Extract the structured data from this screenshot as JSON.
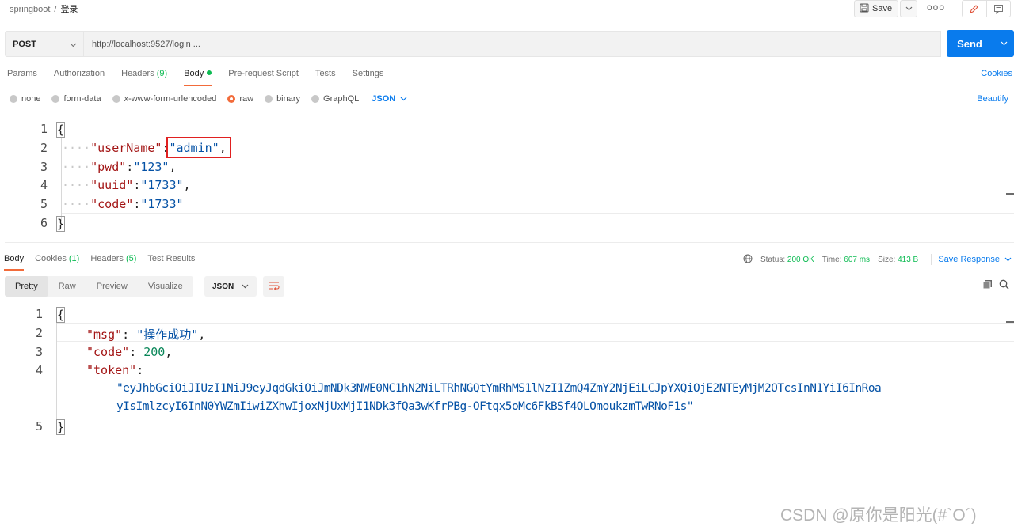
{
  "breadcrumb": {
    "collection": "springboot",
    "separator": "/",
    "request": "登录"
  },
  "toolbar": {
    "save_label": "Save",
    "more": "ooo"
  },
  "request": {
    "method": "POST",
    "url": "http://localhost:9527/login ...",
    "send_label": "Send"
  },
  "req_tabs": [
    {
      "label": "Params"
    },
    {
      "label": "Authorization"
    },
    {
      "label": "Headers",
      "count": " (9)"
    },
    {
      "label": "Body"
    },
    {
      "label": "Pre-request Script"
    },
    {
      "label": "Tests"
    },
    {
      "label": "Settings"
    }
  ],
  "cookies_label": "Cookies",
  "body_types": {
    "none": "none",
    "form_data": "form-data",
    "urlencoded": "x-www-form-urlencoded",
    "raw": "raw",
    "binary": "binary",
    "graphql": "GraphQL",
    "format": "JSON"
  },
  "beautify_label": "Beautify",
  "request_body": {
    "line_numbers": [
      "1",
      "2",
      "3",
      "4",
      "5",
      "6"
    ],
    "open_brace": "{",
    "close_brace": "}",
    "indent": "····",
    "fields": [
      {
        "key": "\"userName\"",
        "sep": ":",
        "value": "\"admin\"",
        "trail": ","
      },
      {
        "key": "\"pwd\"",
        "sep": ":",
        "value": "\"123\"",
        "trail": ","
      },
      {
        "key": "\"uuid\"",
        "sep": ":",
        "value": "\"1733\"",
        "trail": ","
      },
      {
        "key": "\"code\"",
        "sep": ":",
        "value": "\"1733\"",
        "trail": ""
      }
    ]
  },
  "response": {
    "tabs": [
      {
        "label": "Body"
      },
      {
        "label": "Cookies",
        "count": " (1)"
      },
      {
        "label": "Headers",
        "count": " (5)"
      },
      {
        "label": "Test Results"
      }
    ],
    "status_label": "Status:",
    "status_value": "200 OK",
    "time_label": "Time:",
    "time_value": "607 ms",
    "size_label": "Size:",
    "size_value": "413 B",
    "save_label": "Save Response",
    "format_tabs": [
      "Pretty",
      "Raw",
      "Preview",
      "Visualize"
    ],
    "format": "JSON",
    "body": {
      "line_numbers": [
        "1",
        "2",
        "3",
        "4",
        "5"
      ],
      "open_brace": "{",
      "close_brace": "}",
      "msg_key": "\"msg\"",
      "msg_value": "\"操作成功\"",
      "code_key": "\"code\"",
      "code_value": "200",
      "token_key": "\"token\"",
      "token_line1": "\"eyJhbGciOiJIUzI1NiJ9eyJqdGkiOiJmNDk3NWE0NC1hN2NiLTRhNGQtYmRhMS1lNzI1ZmQ4ZmY2NjEiLCJpYXQiOjE2NTEyMjM2OTcsInN1YiI6InRoa",
      "token_line2": "yIsImlzcyI6InN0YWZmIiwiZXhwIjoxNjUxMjI1NDk3fQa3wKfrPBg-OFtqx5oMc6FkBSf4OLOmoukzmTwRNoF1s\""
    },
    "colon": ":",
    "comma": ","
  },
  "watermark": "CSDN @原你是阳光(#`O´)"
}
